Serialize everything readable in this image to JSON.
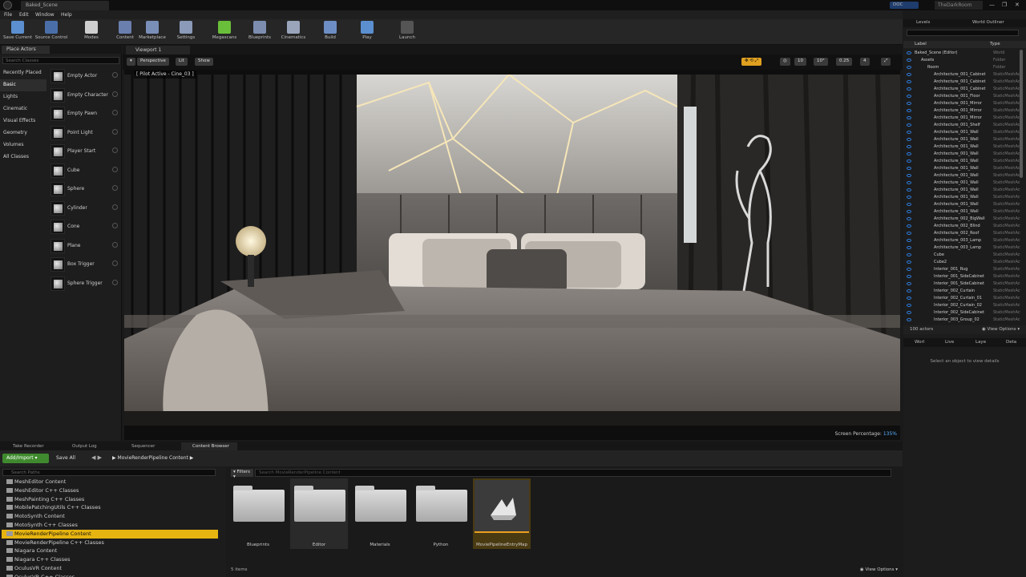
{
  "titlebar": {
    "tab": "Baked_Scene",
    "darkroom": "TheDarkRoom",
    "user": "DOC",
    "min": "—",
    "max": "❐",
    "close": "✕"
  },
  "menu": [
    "File",
    "Edit",
    "Window",
    "Help"
  ],
  "toolbar": [
    {
      "label": "Save Current",
      "color": "#5b8fd0"
    },
    {
      "label": "Source Control",
      "color": "#4a6fa8"
    },
    {
      "label": "Modes",
      "color": "#cfcfcf"
    },
    {
      "label": "Content",
      "color": "#6a7fae"
    },
    {
      "label": "Marketplace",
      "color": "#7a8fb8"
    },
    {
      "label": "Settings",
      "color": "#8a9ab8"
    },
    {
      "label": "Megascans",
      "color": "#6abf3a"
    },
    {
      "label": "Blueprints",
      "color": "#7c8db0"
    },
    {
      "label": "Cinematics",
      "color": "#9aa5bb"
    },
    {
      "label": "Build",
      "color": "#6d8ec4"
    },
    {
      "label": "Play",
      "color": "#5b8fd0"
    },
    {
      "label": "Launch",
      "color": "#555555"
    }
  ],
  "place_actors": {
    "tab": "Place Actors",
    "search_placeholder": "Search Classes",
    "categories": [
      "Recently Placed",
      "Basic",
      "Lights",
      "Cinematic",
      "Visual Effects",
      "Geometry",
      "Volumes",
      "All Classes"
    ],
    "items": [
      "Empty Actor",
      "Empty Character",
      "Empty Pawn",
      "Point Light",
      "Player Start",
      "Cube",
      "Sphere",
      "Cylinder",
      "Cone",
      "Plane",
      "Box Trigger",
      "Sphere Trigger"
    ]
  },
  "viewport": {
    "tab": "Viewport 1",
    "perspective": "Perspective",
    "lit": "Lit",
    "show": "Show",
    "pilot": "[ Pilot Active - Cine_03 ]",
    "screen_pct_label": "Screen Percentage:",
    "screen_pct": "135%",
    "grid": "10",
    "angle": "10°",
    "scale": "0.25",
    "cam": "4"
  },
  "dock_tabs": [
    "Take Recorder",
    "Output Log",
    "Sequencer",
    "Content Browser"
  ],
  "content_browser": {
    "add_import": "Add/Import ▾",
    "save_all": "Save All",
    "nav": "◀ ▶",
    "crumb": "▶  MovieRenderPipeline Content  ▶",
    "path_search": "Search Paths",
    "tree": [
      "MeshEditor Content",
      "MeshEditor C++ Classes",
      "MeshPainting C++ Classes",
      "MobilePatchingUtils C++ Classes",
      "MotoSynth Content",
      "MotoSynth C++ Classes",
      "MovieRenderPipeline Content",
      "MovieRenderPipeline C++ Classes",
      "Niagara Content",
      "Niagara C++ Classes",
      "OculusVR Content",
      "OculusVR C++ Classes"
    ],
    "selected_index": 6,
    "filters": "▾ Filters ▾",
    "search_placeholder": "Search MovieRenderPipeline Content",
    "assets": [
      "Blueprints",
      "Editor",
      "Materials",
      "Python",
      "MoviePipelineEntryMap"
    ],
    "item_count": "5 items",
    "view_options": "◉ View Options ▾"
  },
  "outliner": {
    "levels": "Levels",
    "world_outliner": "World Outliner",
    "col_label": "Label",
    "col_type": "Type",
    "rows": [
      {
        "name": "Baked_Scene (Editor)",
        "type": "World",
        "indent": 0
      },
      {
        "name": "Assets",
        "type": "Folder",
        "indent": 1
      },
      {
        "name": "Room",
        "type": "Folder",
        "indent": 2
      },
      {
        "name": "Architecture_001_Cabinet",
        "type": "StaticMeshActor",
        "indent": 3
      },
      {
        "name": "Architecture_001_Cabinet",
        "type": "StaticMeshActor",
        "indent": 3
      },
      {
        "name": "Architecture_001_Cabinet",
        "type": "StaticMeshActor",
        "indent": 3
      },
      {
        "name": "Architecture_001_Floor",
        "type": "StaticMeshActor",
        "indent": 3
      },
      {
        "name": "Architecture_001_Mirror",
        "type": "StaticMeshActor",
        "indent": 3
      },
      {
        "name": "Architecture_001_Mirror",
        "type": "StaticMeshActor",
        "indent": 3
      },
      {
        "name": "Architecture_001_Mirror",
        "type": "StaticMeshActor",
        "indent": 3
      },
      {
        "name": "Architecture_001_Shelf",
        "type": "StaticMeshActor",
        "indent": 3
      },
      {
        "name": "Architecture_001_Wall",
        "type": "StaticMeshActor",
        "indent": 3
      },
      {
        "name": "Architecture_001_Wall",
        "type": "StaticMeshActor",
        "indent": 3
      },
      {
        "name": "Architecture_001_Wall",
        "type": "StaticMeshActor",
        "indent": 3
      },
      {
        "name": "Architecture_001_Wall",
        "type": "StaticMeshActor",
        "indent": 3
      },
      {
        "name": "Architecture_001_Wall",
        "type": "StaticMeshActor",
        "indent": 3
      },
      {
        "name": "Architecture_001_Wall",
        "type": "StaticMeshActor",
        "indent": 3
      },
      {
        "name": "Architecture_001_Wall",
        "type": "StaticMeshActor",
        "indent": 3
      },
      {
        "name": "Architecture_001_Wall",
        "type": "StaticMeshActor",
        "indent": 3
      },
      {
        "name": "Architecture_001_Wall",
        "type": "StaticMeshActor",
        "indent": 3
      },
      {
        "name": "Architecture_001_Wall",
        "type": "StaticMeshActor",
        "indent": 3
      },
      {
        "name": "Architecture_001_Wall",
        "type": "StaticMeshActor",
        "indent": 3
      },
      {
        "name": "Architecture_001_Wall",
        "type": "StaticMeshActor",
        "indent": 3
      },
      {
        "name": "Architecture_002_BigWall",
        "type": "StaticMeshActor",
        "indent": 3
      },
      {
        "name": "Architecture_002_Blind",
        "type": "StaticMeshActor",
        "indent": 3
      },
      {
        "name": "Architecture_002_Roof",
        "type": "StaticMeshActor",
        "indent": 3
      },
      {
        "name": "Architecture_003_Lamp",
        "type": "StaticMeshActor",
        "indent": 3
      },
      {
        "name": "Architecture_003_Lamp",
        "type": "StaticMeshActor",
        "indent": 3
      },
      {
        "name": "Cube",
        "type": "StaticMeshActor",
        "indent": 3
      },
      {
        "name": "Cube2",
        "type": "StaticMeshActor",
        "indent": 3
      },
      {
        "name": "Interior_001_Rug",
        "type": "StaticMeshActor",
        "indent": 3
      },
      {
        "name": "Interior_001_SideCabinet",
        "type": "StaticMeshActor",
        "indent": 3
      },
      {
        "name": "Interior_001_SideCabinet",
        "type": "StaticMeshActor",
        "indent": 3
      },
      {
        "name": "Interior_002_Curtain",
        "type": "StaticMeshActor",
        "indent": 3
      },
      {
        "name": "Interior_002_Curtain_01",
        "type": "StaticMeshActor",
        "indent": 3
      },
      {
        "name": "Interior_002_Curtain_02",
        "type": "StaticMeshActor",
        "indent": 3
      },
      {
        "name": "Interior_002_SideCabinet",
        "type": "StaticMeshActor",
        "indent": 3
      },
      {
        "name": "Interior_003_Group_02",
        "type": "StaticMeshActor",
        "indent": 3
      }
    ],
    "actor_count": "100 actors",
    "view_options": "◉ View Options ▾"
  },
  "details_tabs": [
    "Worl",
    "Live",
    "Laye",
    "Deta"
  ],
  "details_msg": "Select an object to view details"
}
